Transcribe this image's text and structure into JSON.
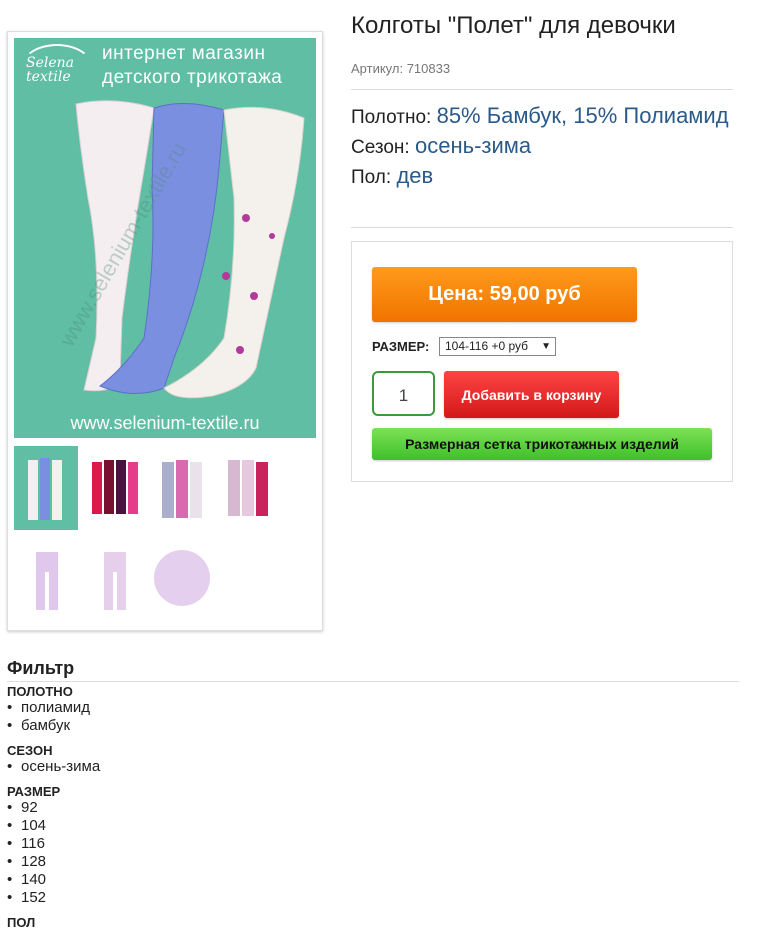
{
  "product": {
    "title": "Колготы \"Полет\" для девочки",
    "sku": "Артикул: 710833",
    "attributes": [
      {
        "label": "Полотно:",
        "value": "85% Бамбук, 15% Полиамид"
      },
      {
        "label": "Сезон:",
        "value": "осень-зима"
      },
      {
        "label": "Пол:",
        "value": "дев"
      }
    ]
  },
  "gallery": {
    "brand": "Selena textile",
    "banner_line1": "интернет магазин",
    "banner_line2": "детского трикотажа",
    "url": "www.selenium-textile.ru",
    "thumbnail_count": 7
  },
  "buy": {
    "price_label": "Цена: 59,00 руб",
    "size_label": "РАЗМЕР:",
    "size_selected": "104-116 +0 руб",
    "quantity": "1",
    "add_to_cart": "Добавить в корзину",
    "size_chart": "Размерная сетка трикотажных изделий"
  },
  "filter": {
    "title": "Фильтр",
    "groups": [
      {
        "name": "ПОЛОТНО",
        "items": [
          "полиамид",
          "бамбук"
        ]
      },
      {
        "name": "СЕЗОН",
        "items": [
          "осень-зима"
        ]
      },
      {
        "name": "РАЗМЕР",
        "items": [
          "92",
          "104",
          "116",
          "128",
          "140",
          "152"
        ]
      },
      {
        "name": "ПОЛ",
        "items": []
      }
    ]
  },
  "colors": {
    "price_button": "#f58400",
    "add_button": "#e02626",
    "size_chart_button": "#5ad23e",
    "image_background": "#5fbea3",
    "attribute_value": "#2a5a8a"
  }
}
